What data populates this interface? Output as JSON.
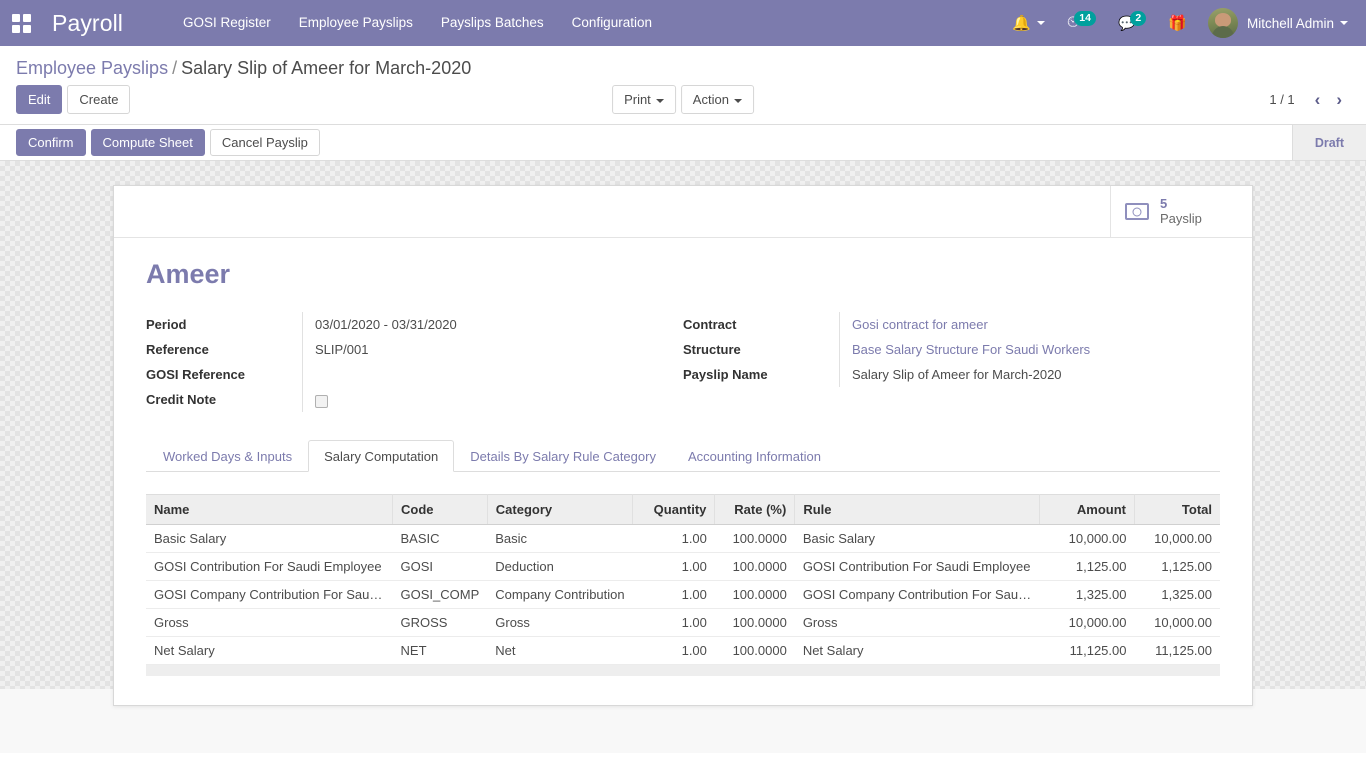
{
  "navbar": {
    "apps_icon": "apps-grid-icon",
    "brand": "Payroll",
    "menu_items": [
      {
        "label": "GOSI Register"
      },
      {
        "label": "Employee Payslips"
      },
      {
        "label": "Payslips Batches"
      },
      {
        "label": "Configuration"
      }
    ],
    "sys_icons": [
      {
        "name": "bell-icon",
        "glyph": "🔔",
        "badge": ""
      },
      {
        "name": "activity-clock-icon",
        "glyph": "◴",
        "badge": "14"
      },
      {
        "name": "messages-icon",
        "glyph": "💬",
        "badge": "2"
      },
      {
        "name": "gift-icon",
        "glyph": "🎁",
        "badge": ""
      }
    ],
    "user": {
      "name": "Mitchell Admin"
    }
  },
  "control_panel": {
    "breadcrumb": {
      "parent": "Employee Payslips",
      "separator": "/",
      "current": "Salary Slip of Ameer for March-2020"
    },
    "edit_label": "Edit",
    "create_label": "Create",
    "print_label": "Print",
    "action_label": "Action",
    "pager": "1 / 1",
    "prev_icon": "‹",
    "next_icon": "›"
  },
  "statusbar": {
    "buttons": [
      {
        "label": "Confirm",
        "style": "primary"
      },
      {
        "label": "Compute Sheet",
        "style": "primary"
      },
      {
        "label": "Cancel Payslip",
        "style": "default"
      }
    ],
    "states": [
      {
        "label": "Draft",
        "active": true
      }
    ]
  },
  "form": {
    "stat_button": {
      "icon": "money-bill-icon",
      "value": "5",
      "label": "Payslip"
    },
    "title": "Ameer",
    "left_fields": [
      {
        "label": "Period",
        "value": "03/01/2020 - 03/31/2020",
        "type": "text"
      },
      {
        "label": "Reference",
        "value": "SLIP/001",
        "type": "text"
      },
      {
        "label": "GOSI Reference",
        "value": "",
        "type": "text"
      },
      {
        "label": "Credit Note",
        "value": "",
        "type": "checkbox",
        "checked": false
      }
    ],
    "right_fields": [
      {
        "label": "Contract",
        "value": "Gosi contract for ameer",
        "type": "link"
      },
      {
        "label": "Structure",
        "value": "Base Salary Structure For Saudi Workers",
        "type": "link"
      },
      {
        "label": "Payslip Name",
        "value": "Salary Slip of Ameer for March-2020",
        "type": "text"
      }
    ]
  },
  "notebook": {
    "tabs": [
      {
        "label": "Worked Days & Inputs",
        "active": false
      },
      {
        "label": "Salary Computation",
        "active": true
      },
      {
        "label": "Details By Salary Rule Category",
        "active": false
      },
      {
        "label": "Accounting Information",
        "active": false
      }
    ]
  },
  "table": {
    "columns": [
      {
        "label": "Name",
        "align": "left"
      },
      {
        "label": "Code",
        "align": "left"
      },
      {
        "label": "Category",
        "align": "left"
      },
      {
        "label": "Quantity",
        "align": "right"
      },
      {
        "label": "Rate (%)",
        "align": "right"
      },
      {
        "label": "Rule",
        "align": "left"
      },
      {
        "label": "Amount",
        "align": "right"
      },
      {
        "label": "Total",
        "align": "right"
      }
    ],
    "rows": [
      {
        "name": "Basic Salary",
        "code": "BASIC",
        "category": "Basic",
        "quantity": "1.00",
        "rate": "100.0000",
        "rule": "Basic Salary",
        "amount": "10,000.00",
        "total": "10,000.00"
      },
      {
        "name": "GOSI Contribution For Saudi Employee",
        "code": "GOSI",
        "category": "Deduction",
        "quantity": "1.00",
        "rate": "100.0000",
        "rule": "GOSI Contribution For Saudi Employee",
        "amount": "1,125.00",
        "total": "1,125.00"
      },
      {
        "name": "GOSI Company Contribution For Sau…",
        "code": "GOSI_COMP",
        "category": "Company Contribution",
        "quantity": "1.00",
        "rate": "100.0000",
        "rule": "GOSI Company Contribution For Sau…",
        "amount": "1,325.00",
        "total": "1,325.00"
      },
      {
        "name": "Gross",
        "code": "GROSS",
        "category": "Gross",
        "quantity": "1.00",
        "rate": "100.0000",
        "rule": "Gross",
        "amount": "10,000.00",
        "total": "10,000.00"
      },
      {
        "name": "Net Salary",
        "code": "NET",
        "category": "Net",
        "quantity": "1.00",
        "rate": "100.0000",
        "rule": "Net Salary",
        "amount": "11,125.00",
        "total": "11,125.00"
      }
    ]
  },
  "colors": {
    "brand_purple": "#7c7bad",
    "badge_teal": "#00a09d",
    "text_dark": "#4c4c4c"
  }
}
